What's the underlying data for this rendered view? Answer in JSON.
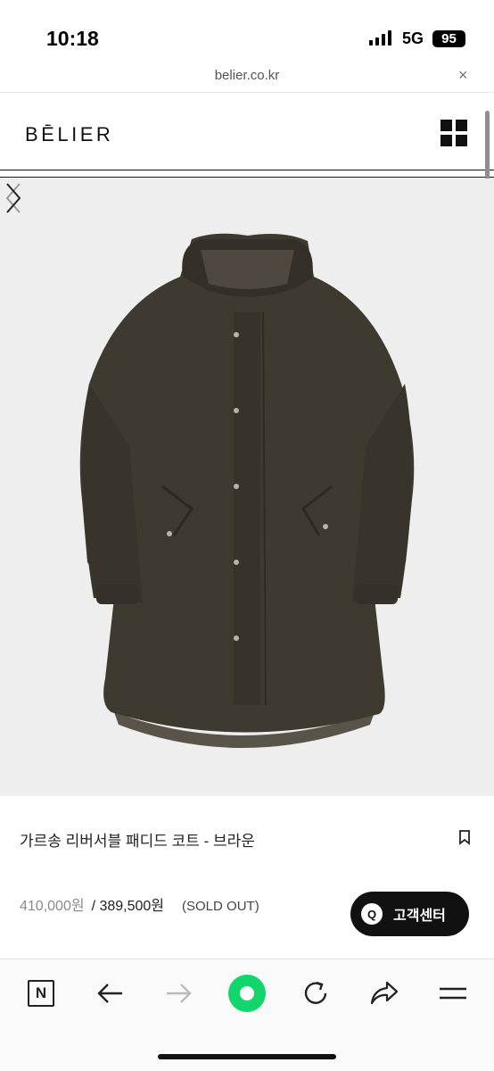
{
  "status_bar": {
    "time": "10:18",
    "network": "5G",
    "battery": "95"
  },
  "browser": {
    "url": "belier.co.kr",
    "close_glyph": "×"
  },
  "header": {
    "logo": "BĒLIER",
    "menu_icon": "grid-menu-icon"
  },
  "product": {
    "image_icon": "padded-coat-image",
    "title": "가르송 리버서블 패디드 코트 - 브라운",
    "original_price": "410,000원",
    "sale_price": "/ 389,500원",
    "status": "(SOLD OUT)",
    "coat_color": "#3e3a30",
    "background_color": "#eeeeee"
  },
  "customer_service": {
    "icon_label": "Q",
    "label": "고객센터"
  },
  "toolbar": {
    "naver_label": "N",
    "accent_color": "#12d66b"
  }
}
